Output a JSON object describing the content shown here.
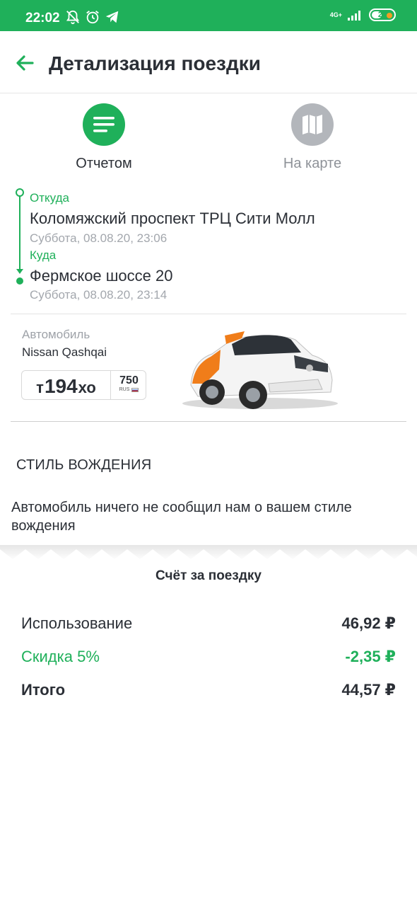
{
  "status_bar": {
    "time": "22:02",
    "network": "4G+",
    "battery": "25"
  },
  "header": {
    "title": "Детализация поездки"
  },
  "view_toggle": {
    "report_label": "Отчетом",
    "map_label": "На карте"
  },
  "route": {
    "from_label": "Откуда",
    "from_address": "Коломяжский проспект ТРЦ Сити Молл",
    "from_time": "Суббота, 08.08.20, 23:06",
    "to_label": "Куда",
    "to_address": "Фермское шоссе 20",
    "to_time": "Суббота, 08.08.20, 23:14"
  },
  "car": {
    "caption": "Автомобиль",
    "model": "Nissan Qashqai",
    "plate": {
      "letter1": "т",
      "number": "194",
      "letters2": "хо",
      "region": "750",
      "country": "RUS"
    }
  },
  "driving_style": {
    "heading": "СТИЛЬ ВОЖДЕНИЯ",
    "text": "Автомобиль ничего не сообщил нам о вашем стиле вождения"
  },
  "bill": {
    "title": "Счёт за поездку",
    "usage_label": "Использование",
    "usage_value": "46,92 ₽",
    "discount_label": "Скидка 5%",
    "discount_value": "-2,35 ₽",
    "total_label": "Итого",
    "total_value": "44,57 ₽"
  },
  "colors": {
    "accent": "#1fb05a",
    "inactive": "#b3b6bb",
    "text": "#2b2f36",
    "muted": "#a3a7ad"
  }
}
